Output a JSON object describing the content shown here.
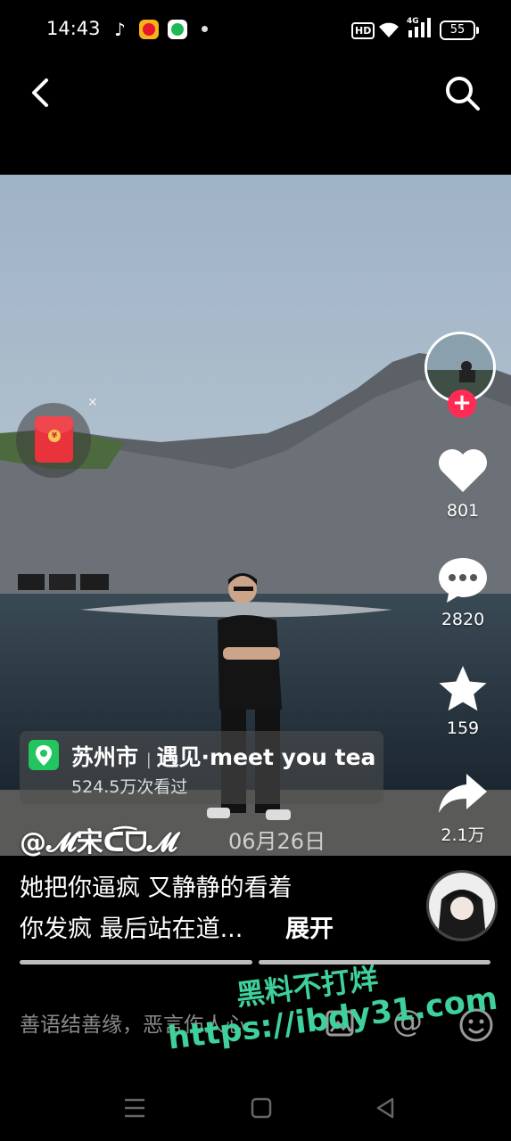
{
  "status_bar": {
    "time": "14:43",
    "hd": "HD",
    "network": "4G",
    "battery": "55"
  },
  "video": {
    "location": {
      "city": "苏州市",
      "place": "遇见·meet you tea",
      "views": "524.5万次看过"
    },
    "author": "@𝓜宋ᑕ͡ᗜ𝓜",
    "date": "06月26日",
    "caption_line1": "她把你逼疯 又静静的看着",
    "caption_line2": "你发疯 最后站在道...",
    "expand_label": "展开"
  },
  "actions": {
    "likes": "801",
    "comments": "2820",
    "favorites": "159",
    "shares": "2.1万"
  },
  "comment_bar": {
    "placeholder": "善语结善缘，恶言伤人心"
  },
  "watermark": {
    "line1": "黑料不打烊",
    "line2": "https://ibdy31.com"
  },
  "icons": {
    "back": "chevron-left-icon",
    "search": "search-icon",
    "like": "heart-icon",
    "comment": "comment-bubble-icon",
    "favorite": "star-icon",
    "share": "share-arrow-icon",
    "emoji": "smile-icon",
    "image": "image-icon",
    "at": "at-icon"
  },
  "colors": {
    "follow_accent": "#fe2c55",
    "location_pin": "#22c55e",
    "red_packet": "#e8323c",
    "watermark": "#3fd19b"
  }
}
